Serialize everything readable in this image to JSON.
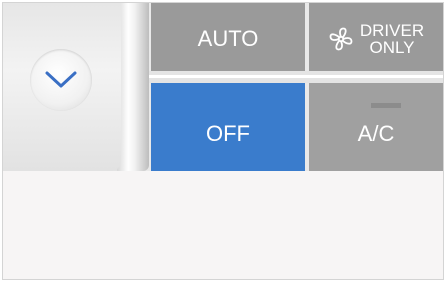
{
  "controls": {
    "auto_label": "AUTO",
    "driver_only_line1": "DRIVER",
    "driver_only_line2": "ONLY",
    "off_label": "OFF",
    "ac_label": "A/C"
  },
  "icons": {
    "knob": "chevron-down-icon",
    "driver_only": "fan-icon"
  },
  "colors": {
    "off_active": "#3a7ccc",
    "button_gray": "#9a9a9a"
  }
}
